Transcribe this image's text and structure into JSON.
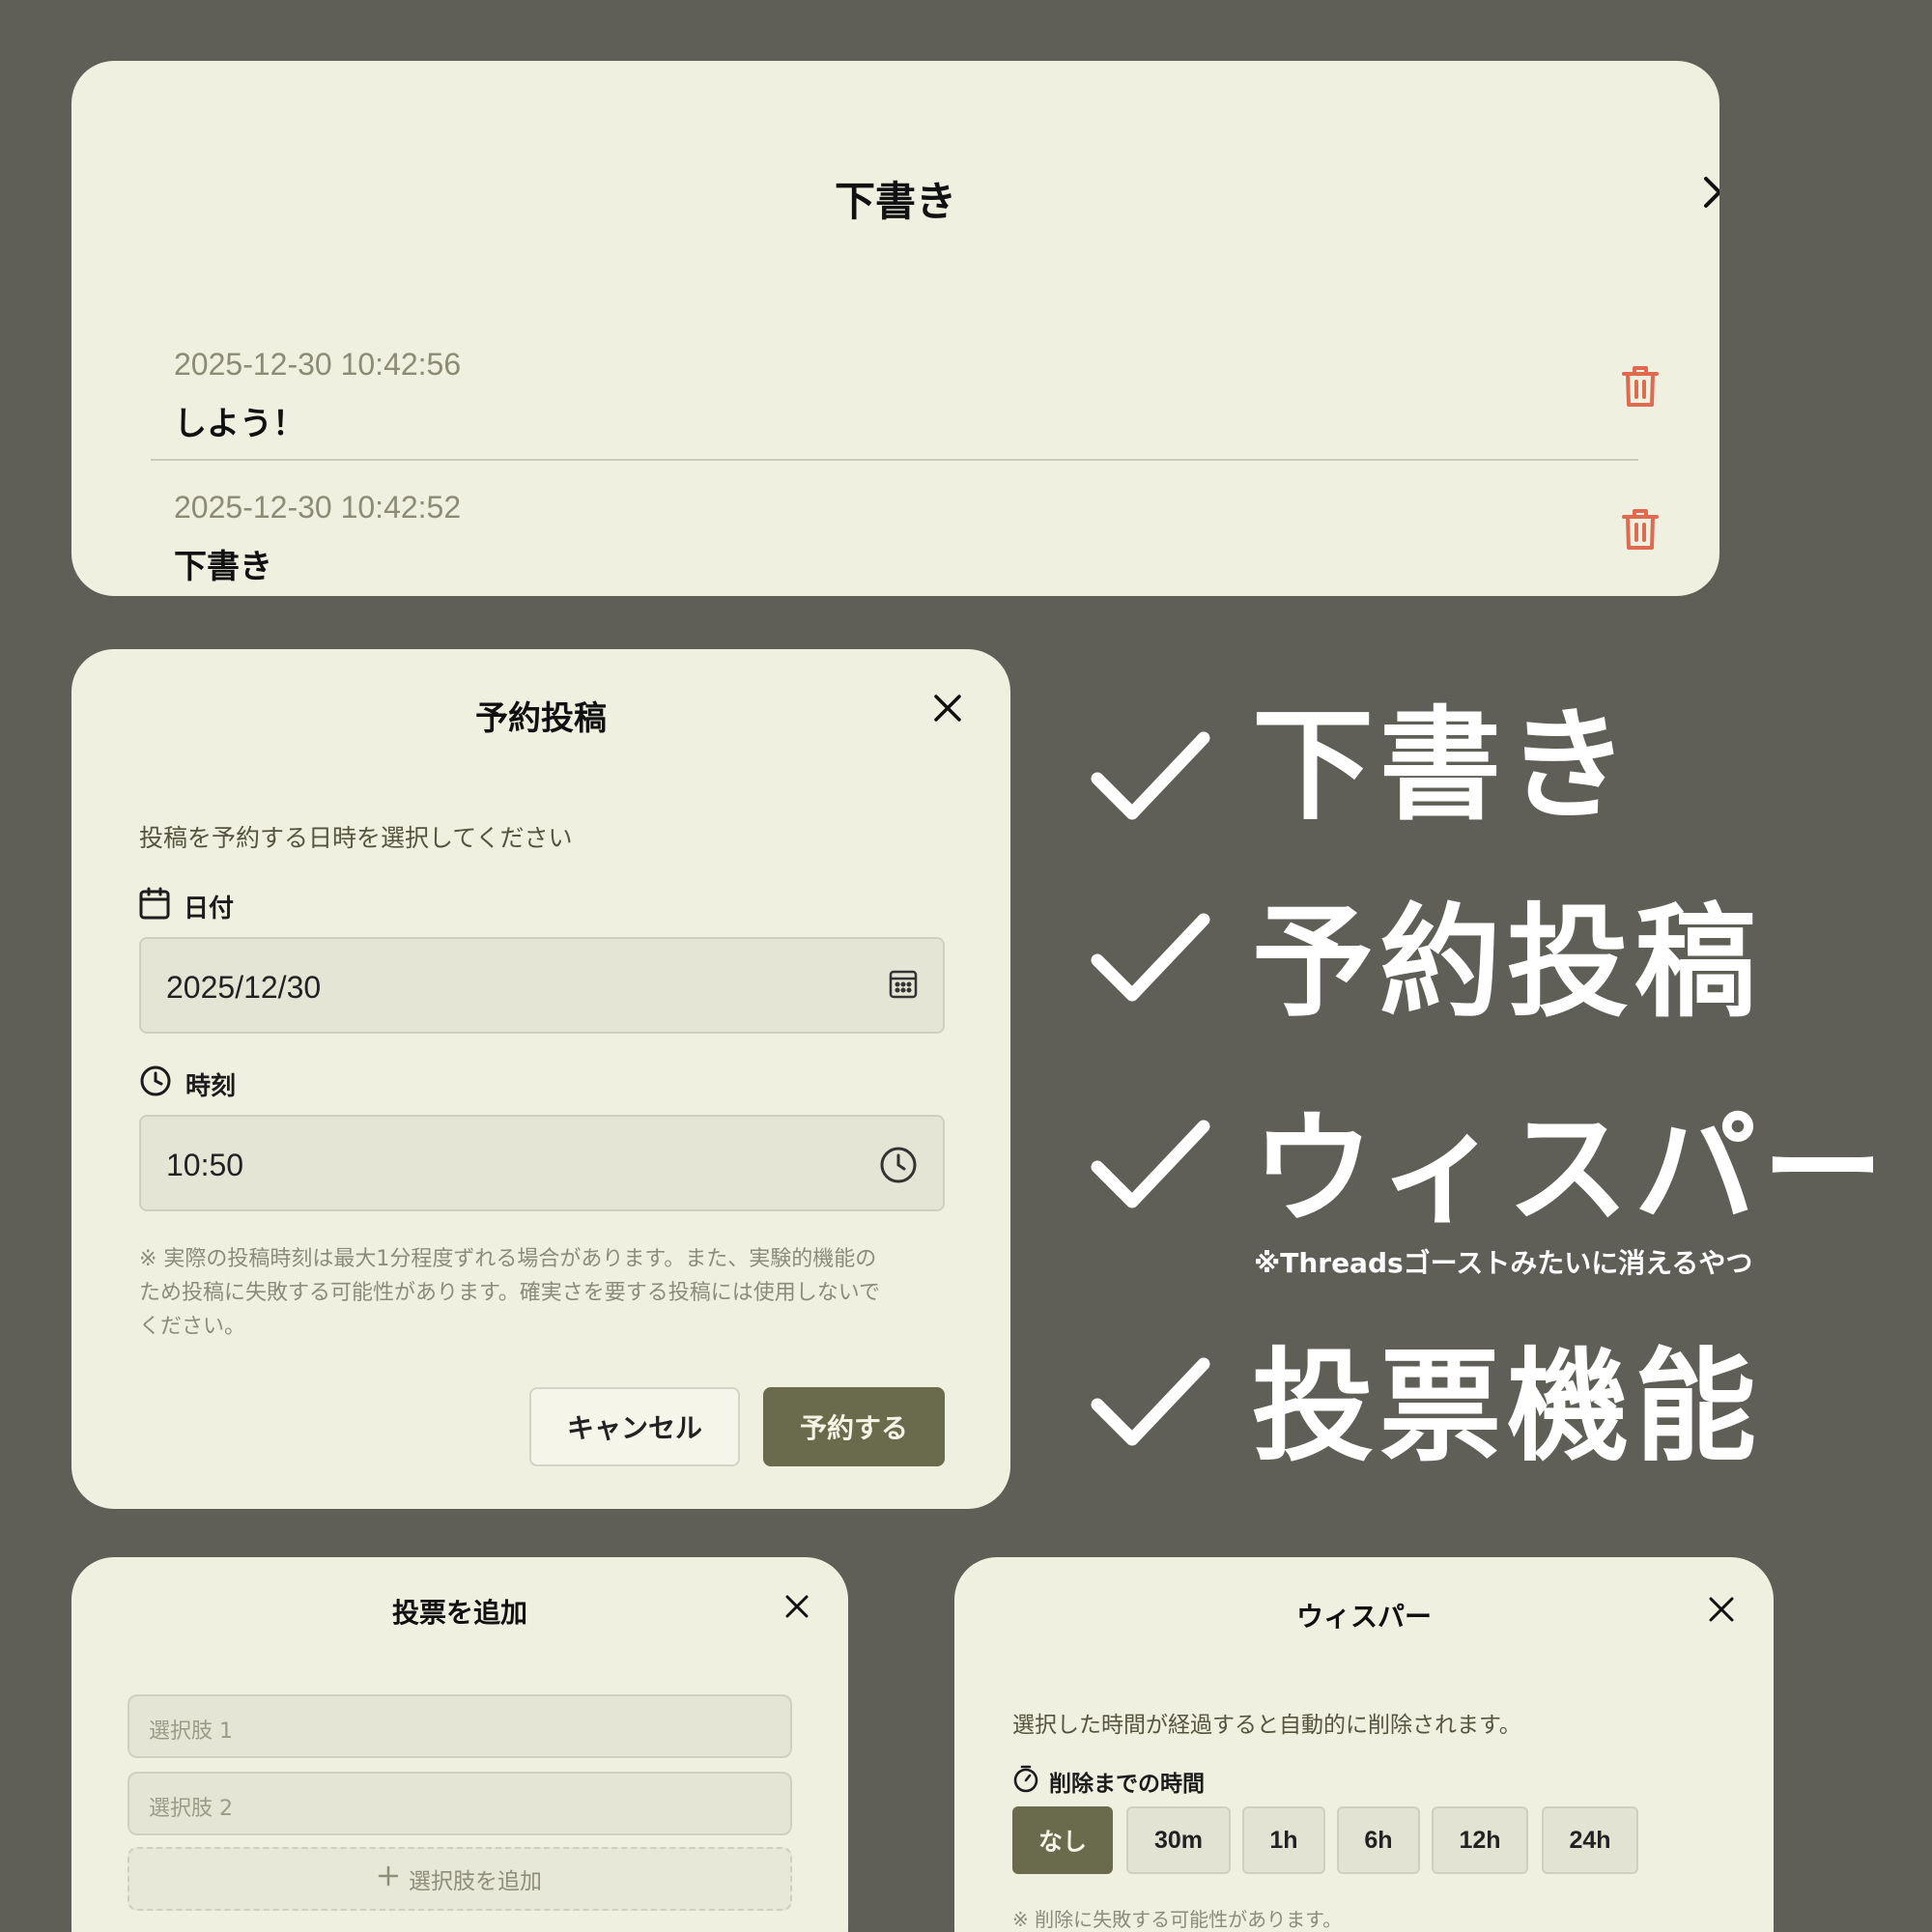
{
  "drafts": {
    "title": "下書き",
    "items": [
      {
        "date": "2025-12-30 10:42:56",
        "text": "しよう！"
      },
      {
        "date": "2025-12-30 10:42:52",
        "text": "下書き"
      }
    ]
  },
  "schedule": {
    "title": "予約投稿",
    "description": "投稿を予約する日時を選択してください",
    "date_label": "日付",
    "date_value": "2025/12/30",
    "time_label": "時刻",
    "time_value": "10:50",
    "note_lines": [
      "※ 実際の投稿時刻は最大1分程度ずれる場合があります。また、実験的機能の",
      "ため投稿に失敗する可能性があります。確実さを要する投稿には使用しないで",
      "ください。"
    ],
    "cancel_label": "キャンセル",
    "submit_label": "予約する"
  },
  "features": {
    "items": [
      "下書き",
      "予約投稿",
      "ウィスパー",
      "投票機能"
    ],
    "whisper_note": "※Threadsゴーストみたいに消えるやつ"
  },
  "poll": {
    "title": "投票を追加",
    "option_placeholders": [
      "選択肢 1",
      "選択肢 2"
    ],
    "add_option_label": "選択肢を追加"
  },
  "whisper": {
    "title": "ウィスパー",
    "description": "選択した時間が経過すると自動的に削除されます。",
    "duration_label": "削除までの時間",
    "options": [
      "なし",
      "30m",
      "1h",
      "6h",
      "12h",
      "24h"
    ],
    "selected": "なし",
    "note": "※ 削除に失敗する可能性があります。"
  },
  "colors": {
    "background": "#5f5f58",
    "card": "#f0f0e1",
    "accent": "#6a6a4c",
    "danger": "#e06a50"
  }
}
